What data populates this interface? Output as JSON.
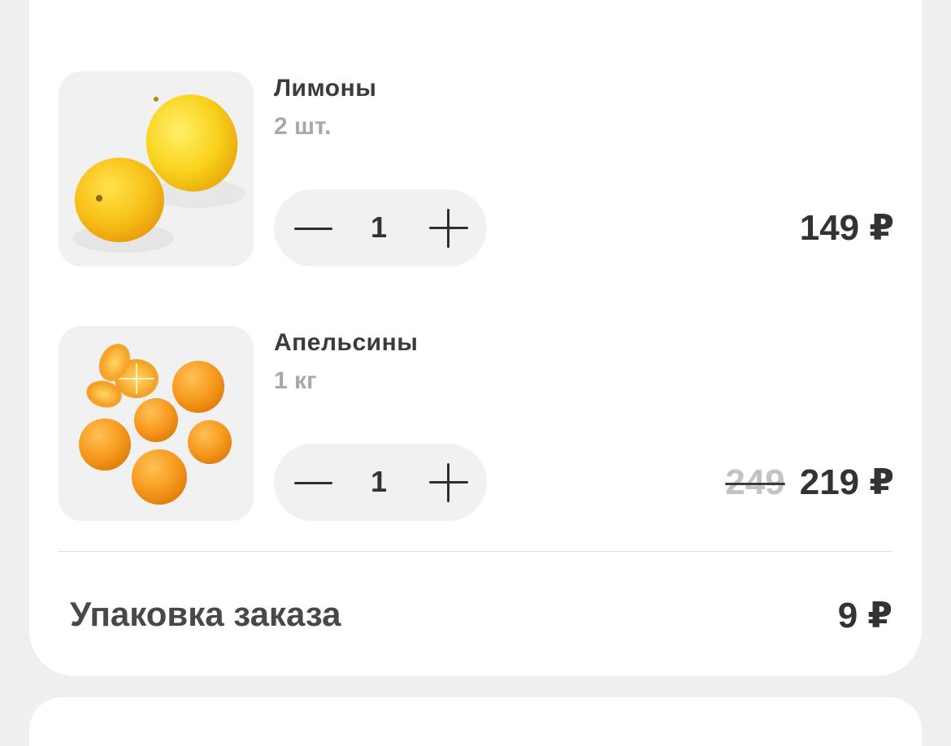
{
  "cart": {
    "items": [
      {
        "name": "Лимоны",
        "unit": "2 шт.",
        "quantity": "1",
        "price": "149 ₽",
        "old_price": "",
        "image_icon": "lemons-image"
      },
      {
        "name": "Апельсины",
        "unit": "1 кг",
        "quantity": "1",
        "price": "219 ₽",
        "old_price": "249",
        "image_icon": "oranges-image"
      }
    ],
    "packaging": {
      "label": "Упаковка заказа",
      "price": "9 ₽"
    }
  },
  "colors": {
    "background": "#efefef",
    "card": "#ffffff",
    "stepper_bg": "#f1f1f1",
    "text_primary": "#333333",
    "text_secondary": "#a9a9a9",
    "lemon": "#f7c516",
    "orange": "#f79a1e"
  },
  "icons": [
    "minus-icon",
    "plus-icon",
    "lemons-image",
    "oranges-image"
  ]
}
